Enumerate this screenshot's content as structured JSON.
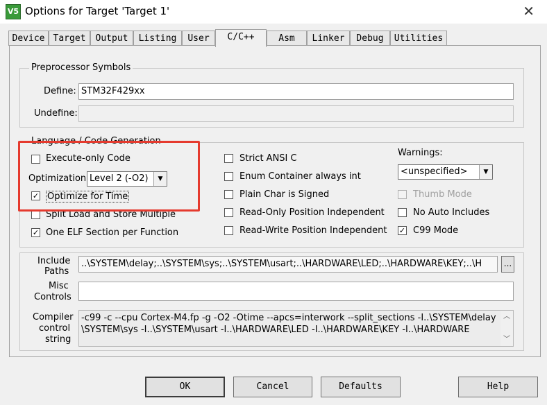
{
  "window": {
    "title": "Options for Target 'Target 1'",
    "app_icon_text": "V5",
    "close_glyph": "✕"
  },
  "tabs": [
    {
      "label": "Device"
    },
    {
      "label": "Target"
    },
    {
      "label": "Output"
    },
    {
      "label": "Listing"
    },
    {
      "label": "User"
    },
    {
      "label": "C/C++",
      "active": true
    },
    {
      "label": "Asm"
    },
    {
      "label": "Linker"
    },
    {
      "label": "Debug"
    },
    {
      "label": "Utilities"
    }
  ],
  "preprocessor": {
    "group_label": "Preprocessor Symbols",
    "define_label": "Define:",
    "define_value": "STM32F429xx",
    "undefine_label": "Undefine:",
    "undefine_value": ""
  },
  "language": {
    "group_label": "Language / Code Generation",
    "execute_only": {
      "label": "Execute-only Code",
      "checked": false
    },
    "optimization_label": "Optimization:",
    "optimization_value": "Level 2 (-O2)",
    "optimize_for_time": {
      "label": "Optimize for Time",
      "checked": true
    },
    "split_load_store": {
      "label": "Split Load and Store Multiple",
      "checked": false
    },
    "one_elf_section": {
      "label": "One ELF Section per Function",
      "checked": true
    },
    "strict_ansi": {
      "label": "Strict ANSI C",
      "checked": false
    },
    "enum_container": {
      "label": "Enum Container always int",
      "checked": false
    },
    "plain_char": {
      "label": "Plain Char is Signed",
      "checked": false
    },
    "ro_position": {
      "label": "Read-Only Position Independent",
      "checked": false
    },
    "rw_position": {
      "label": "Read-Write Position Independent",
      "checked": false
    },
    "warnings_label": "Warnings:",
    "warnings_value": "<unspecified>",
    "thumb_mode": {
      "label": "Thumb Mode",
      "checked": false,
      "disabled": true
    },
    "no_auto_includes": {
      "label": "No Auto Includes",
      "checked": false
    },
    "c99_mode": {
      "label": "C99 Mode",
      "checked": true
    }
  },
  "include_paths": {
    "label_line1": "Include",
    "label_line2": "Paths",
    "value": "..\\SYSTEM\\delay;..\\SYSTEM\\sys;..\\SYSTEM\\usart;..\\HARDWARE\\LED;..\\HARDWARE\\KEY;..\\H",
    "browse_label": "..."
  },
  "misc_controls": {
    "label_line1": "Misc",
    "label_line2": "Controls",
    "value": ""
  },
  "compiler_string": {
    "label_line1": "Compiler",
    "label_line2": "control",
    "label_line3": "string",
    "line1": "-c99 -c --cpu Cortex-M4.fp -g -O2 -Otime --apcs=interwork --split_sections -I..\\SYSTEM\\delay -I..",
    "line2": "\\SYSTEM\\sys -I..\\SYSTEM\\usart -I..\\HARDWARE\\LED -I..\\HARDWARE\\KEY -I..\\HARDWARE"
  },
  "buttons": {
    "ok": "OK",
    "cancel": "Cancel",
    "defaults": "Defaults",
    "help": "Help"
  },
  "colors": {
    "highlight": "#e53a2e",
    "dialog_bg": "#f0f0f0"
  }
}
